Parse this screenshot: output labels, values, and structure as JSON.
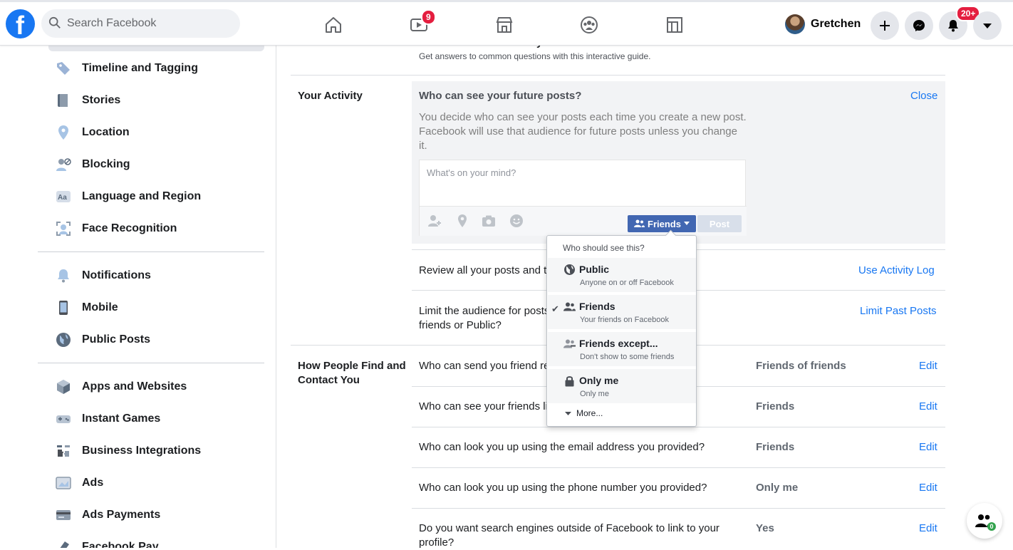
{
  "header": {
    "logo": "f",
    "search_placeholder": "Search Facebook",
    "watch_badge": "9",
    "notifications_badge": "20+",
    "profile_name": "Gretchen"
  },
  "sidebar": {
    "items": [
      {
        "label": "Timeline and Tagging",
        "icon": "tag-icon"
      },
      {
        "label": "Stories",
        "icon": "book-icon"
      },
      {
        "label": "Location",
        "icon": "location-pin-icon"
      },
      {
        "label": "Blocking",
        "icon": "blocked-user-icon"
      },
      {
        "label": "Language and Region",
        "icon": "language-icon"
      },
      {
        "label": "Face Recognition",
        "icon": "face-recognition-icon"
      },
      {
        "label": "Notifications",
        "icon": "bell-icon"
      },
      {
        "label": "Mobile",
        "icon": "phone-icon"
      },
      {
        "label": "Public Posts",
        "icon": "globe-icon"
      },
      {
        "label": "Apps and Websites",
        "icon": "cube-icon"
      },
      {
        "label": "Instant Games",
        "icon": "gamepad-icon"
      },
      {
        "label": "Business Integrations",
        "icon": "puzzle-icon"
      },
      {
        "label": "Ads",
        "icon": "ads-icon"
      },
      {
        "label": "Ads Payments",
        "icon": "credit-card-icon"
      },
      {
        "label": "Facebook Pay",
        "icon": "pay-icon"
      }
    ]
  },
  "privacy_basics": {
    "title": "Learn more with Privacy Basics",
    "subtitle": "Get answers to common questions with this interactive guide."
  },
  "your_activity": {
    "section_label": "Your Activity",
    "expanded_title": "Who can see your future posts?",
    "close_label": "Close",
    "description": "You decide who can see your posts each time you create a new post. Facebook will use that audience for future posts unless you change it.",
    "composer_placeholder": "What's on your mind?",
    "audience_button": "Friends",
    "post_button": "Post",
    "review_text": "Review all your posts and th",
    "review_link": "Use Activity Log",
    "limit_text_1": "Limit the audience for posts",
    "limit_text_2": "friends or Public?",
    "limit_link": "Limit Past Posts"
  },
  "find_contact": {
    "section_label_1": "How People Find and",
    "section_label_2": "Contact You",
    "rows": [
      {
        "question": "Who can send you friend re",
        "value": "Friends of friends",
        "action": "Edit"
      },
      {
        "question": "Who can see your friends li",
        "value": "Friends",
        "action": "Edit"
      },
      {
        "question": "Who can look you up using the email address you provided?",
        "value": "Friends",
        "action": "Edit"
      },
      {
        "question": "Who can look you up using the phone number you provided?",
        "value": "Only me",
        "action": "Edit"
      },
      {
        "question": "Do you want search engines outside of Facebook to link to your",
        "question_2": "profile?",
        "value": "Yes",
        "action": "Edit"
      }
    ]
  },
  "audience_dropdown": {
    "header": "Who should see this?",
    "options": [
      {
        "title": "Public",
        "subtitle": "Anyone on or off Facebook",
        "icon": "globe-icon"
      },
      {
        "title": "Friends",
        "subtitle": "Your friends on Facebook",
        "icon": "friends-icon",
        "selected": true
      },
      {
        "title": "Friends except...",
        "subtitle": "Don't show to some friends",
        "icon": "friends-except-icon"
      },
      {
        "title": "Only me",
        "subtitle": "Only me",
        "icon": "lock-icon"
      }
    ],
    "more_label": "More..."
  },
  "chat_badge": "0",
  "colors": {
    "brand": "#1877f2",
    "button_blue": "#4267b2",
    "badge_red": "#e41e3f"
  }
}
